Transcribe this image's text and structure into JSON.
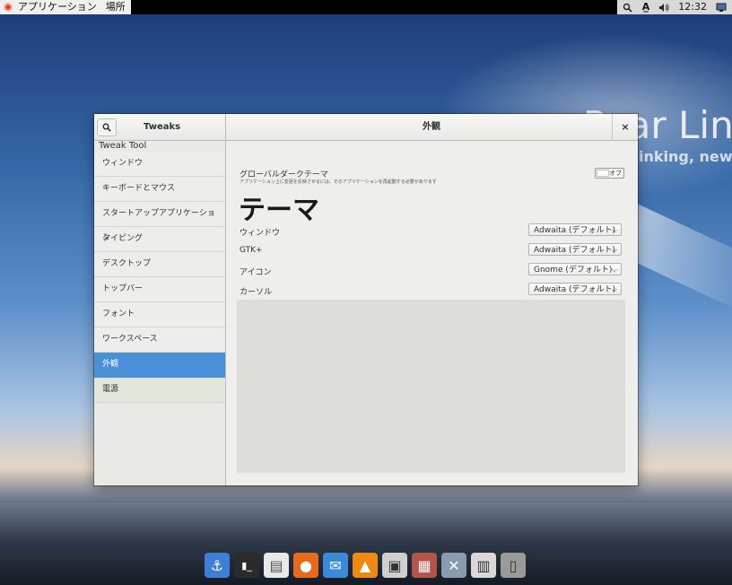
{
  "top_panel": {
    "apps_label": "アプリケーション",
    "places_label": "場所",
    "input_method": "A̲",
    "clock": "12:32"
  },
  "desktop": {
    "brand_text": "Pear Lin",
    "tagline": "inking, new p"
  },
  "window": {
    "sidebar_title": "Tweaks",
    "content_title": "外観",
    "sidebar_caption": "Tweak Tool",
    "sidebar_items": [
      {
        "label": "ウィンドウ"
      },
      {
        "label": "キーボードとマウス"
      },
      {
        "label": "スタートアップアプリケーション"
      },
      {
        "label": "タイピング"
      },
      {
        "label": "デスクトップ"
      },
      {
        "label": "トップバー"
      },
      {
        "label": "フォント"
      },
      {
        "label": "ワークスペース"
      },
      {
        "label": "外観"
      },
      {
        "label": "電源"
      }
    ],
    "selected_index": 8
  },
  "appearance": {
    "global_dark_label": "グローバルダークテーマ",
    "global_dark_note": "アプリケーション上に変更を反映させるには、そのアプリケーションを再起動する必要があります",
    "switch_state": "オフ",
    "theme_heading": "テーマ",
    "rows": [
      {
        "label": "ウィンドウ",
        "value": "Adwaita (デフォルト)"
      },
      {
        "label": "GTK+",
        "value": "Adwaita (デフォルト)"
      },
      {
        "label": "アイコン",
        "value": "Gnome (デフォルト)"
      },
      {
        "label": "カーソル",
        "value": "Adwaita (デフォルト)"
      }
    ]
  },
  "dock": {
    "items": [
      {
        "icon": "anchor-icon",
        "color": "#3d7fd6"
      },
      {
        "icon": "terminal-icon",
        "color": "#2b2b2b"
      },
      {
        "icon": "text-editor-icon",
        "color": "#e8e8e8"
      },
      {
        "icon": "firefox-icon",
        "color": "#e86a1c"
      },
      {
        "icon": "thunderbird-icon",
        "color": "#3b8ad8"
      },
      {
        "icon": "vlc-icon",
        "color": "#ef8a10"
      },
      {
        "icon": "screenshot-icon",
        "color": "#cfcfcf"
      },
      {
        "icon": "package-installer-icon",
        "color": "#b4544a"
      },
      {
        "icon": "settings-tools-icon",
        "color": "#8a9bb0"
      },
      {
        "icon": "system-monitor-icon",
        "color": "#d9d9d9"
      },
      {
        "icon": "trash-icon",
        "color": "#9a9a9a"
      }
    ]
  }
}
